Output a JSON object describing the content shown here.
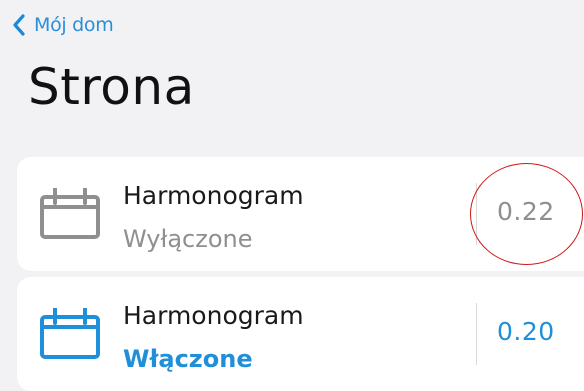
{
  "nav": {
    "back_label": "Mój dom"
  },
  "page": {
    "title": "Strona"
  },
  "schedules": [
    {
      "name": "Harmonogram",
      "status": "Wyłączone",
      "time": "0.22",
      "enabled": false,
      "color": "#8f8f8f"
    },
    {
      "name": "Harmonogram",
      "status": "Włączone",
      "time": "0.20",
      "enabled": true,
      "color": "#1f8fd9"
    }
  ],
  "colors": {
    "accent": "#1f8fd9",
    "annotation": "#d01818"
  },
  "icons": {
    "back": "chevron-left-icon",
    "schedule": "calendar-icon"
  }
}
